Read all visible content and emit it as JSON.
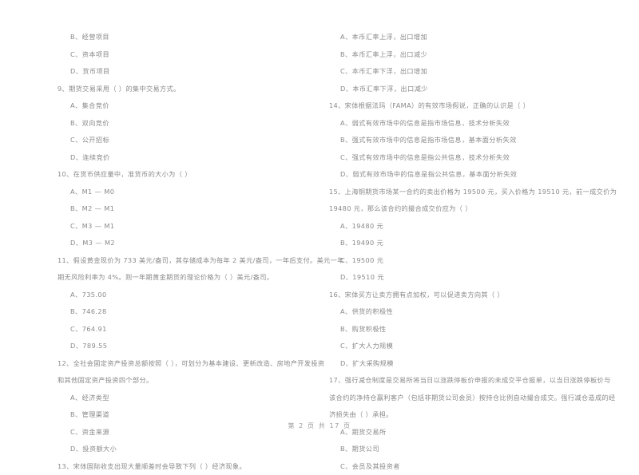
{
  "document": {
    "type": "scanned-exam-paper",
    "footer": "第 2 页 共 17 页"
  },
  "left_column": {
    "orphan_options": [
      "B、经营项目",
      "C、资本项目",
      "D、货币项目"
    ],
    "questions": [
      {
        "number": "9",
        "lines": [
          "9、期货交易采用（      ）的集中交易方式。"
        ],
        "options": [
          "A、集合竞价",
          "B、双向竞价",
          "C、公开招标",
          "D、连续竞价"
        ]
      },
      {
        "number": "10",
        "lines": [
          "10、在货币供应量中，准货币的大小为（      ）"
        ],
        "options": [
          "A、M1 — M0",
          "B、M2 — M1",
          "C、M3 — M1",
          "D、M3 — M2"
        ]
      },
      {
        "number": "11",
        "lines": [
          "11、假设黄金现价为 733 美元/盎司，其存储成本为每年 2 美元/盎司，一年后支付。美元一年",
          "期无风险利率为 4%。则一年期黄金期货的理论价格为（      ）美元/盎司。"
        ],
        "options": [
          "A、735.00",
          "B、746.28",
          "C、764.91",
          "D、789.55"
        ]
      },
      {
        "number": "12",
        "lines": [
          "12、全社会固定资产投资总额按照（      ），可划分为基本建设、更新改造、房地产开发投资",
          "和其他固定资产投资四个部分。"
        ],
        "options": [
          "A、经济类型",
          "B、管理渠道",
          "C、资金来源",
          "D、投资额大小"
        ]
      },
      {
        "number": "13",
        "lines": [
          "13、宋体国际收支出现大量顺差时会导致下列（      ）经济现象。"
        ],
        "options": []
      }
    ]
  },
  "right_column": {
    "orphan_options": [
      "A、本币汇率上浮，出口增加",
      "B、本币汇率上浮，出口减少",
      "C、本币汇率下浮，出口增加",
      "D、本币汇率下浮，出口减少"
    ],
    "questions": [
      {
        "number": "14",
        "lines": [
          "14、宋体根据法玛（FAMA）的有效市场假说，正确的认识是（      ）"
        ],
        "options": [
          "A、弱式有效市场中的信息是指市场信息，技术分析失效",
          "B、强式有效市场中的信息是指市场信息，基本面分析失效",
          "C、强式有效市场中的信息是指公共信息，技术分析失效",
          "D、弱式有效市场中的信息是指公共信息，基本面分析失效"
        ]
      },
      {
        "number": "15",
        "lines": [
          "15、上海铜期货市场某一合约的卖出价格为 19500 元，买入价格为 19510 元，前一成交价为",
          "19480 元，那么该合约的撮合成交价应为（      ）"
        ],
        "options": [
          "A、19480 元",
          "B、19490 元",
          "C、19500 元",
          "D、19510 元"
        ]
      },
      {
        "number": "16",
        "lines": [
          "16、宋体买方让卖方拥有点加权，可以促进卖方向其（      ）"
        ],
        "options": [
          "A、供货的积极性",
          "B、购货积极性",
          "C、扩大人力规模",
          "D、扩大采购规模"
        ]
      },
      {
        "number": "17",
        "lines": [
          "17、强行减仓制度是交易所将当日以涨跌停板价申报的未成交平仓报单，以当日涨跌停板价与",
          "该合约的净持仓赢利客户（包括非期货公司会员）按持仓比例自动撮合成交。强行减仓造成的经",
          "济损失由（      ）承担。"
        ],
        "options": [
          "A、期货交易所",
          "B、期货公司",
          "C、会员及其投资者"
        ]
      }
    ]
  }
}
